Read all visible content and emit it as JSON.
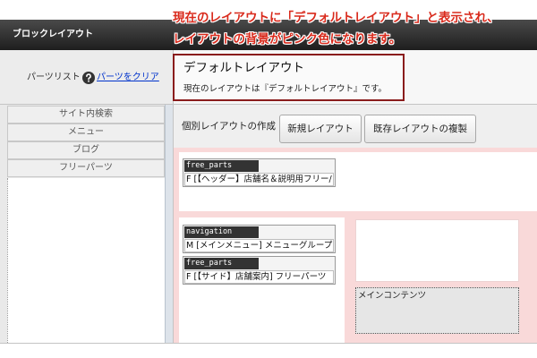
{
  "annotation": {
    "line1": "現在のレイアウトに「デフォルトレイアウト」と表示され、",
    "line2": "レイアウトの背景がピンク色になります。"
  },
  "header": {
    "title": "ブロックレイアウト"
  },
  "parts_panel": {
    "label": "パーツリスト",
    "help_icon": "question-circle-icon",
    "clear_link": "パーツをクリア",
    "items": [
      "サイト内検索",
      "メニュー",
      "ブログ",
      "フリーパーツ"
    ]
  },
  "current_layout": {
    "name": "デフォルトレイアウト",
    "message": "現在のレイアウトは『デフォルトレイアウト』です。"
  },
  "toolbar": {
    "label": "個別レイアウトの作成",
    "new_layout_button": "新規レイアウト",
    "duplicate_button": "既存レイアウトの複製"
  },
  "layout": {
    "header_area": [
      {
        "type": "free_parts",
        "text": "F [【ヘッダー】店舗名＆説明用フリー/"
      }
    ],
    "side_area": [
      {
        "type": "navigation",
        "text": "M [メインメニュー] メニューグループ"
      },
      {
        "type": "free_parts",
        "text": "F [【サイド】店舗案内] フリーパーツ"
      }
    ],
    "main_area": {
      "label": "メインコンテンツ"
    }
  },
  "colors": {
    "annotation": "#d92a1c",
    "layout_background": "#f9d9d9",
    "current_layout_border": "#8a1c1c",
    "link": "#0033cc",
    "header_bar": "#1e1e1e",
    "block_label": "#333333"
  }
}
